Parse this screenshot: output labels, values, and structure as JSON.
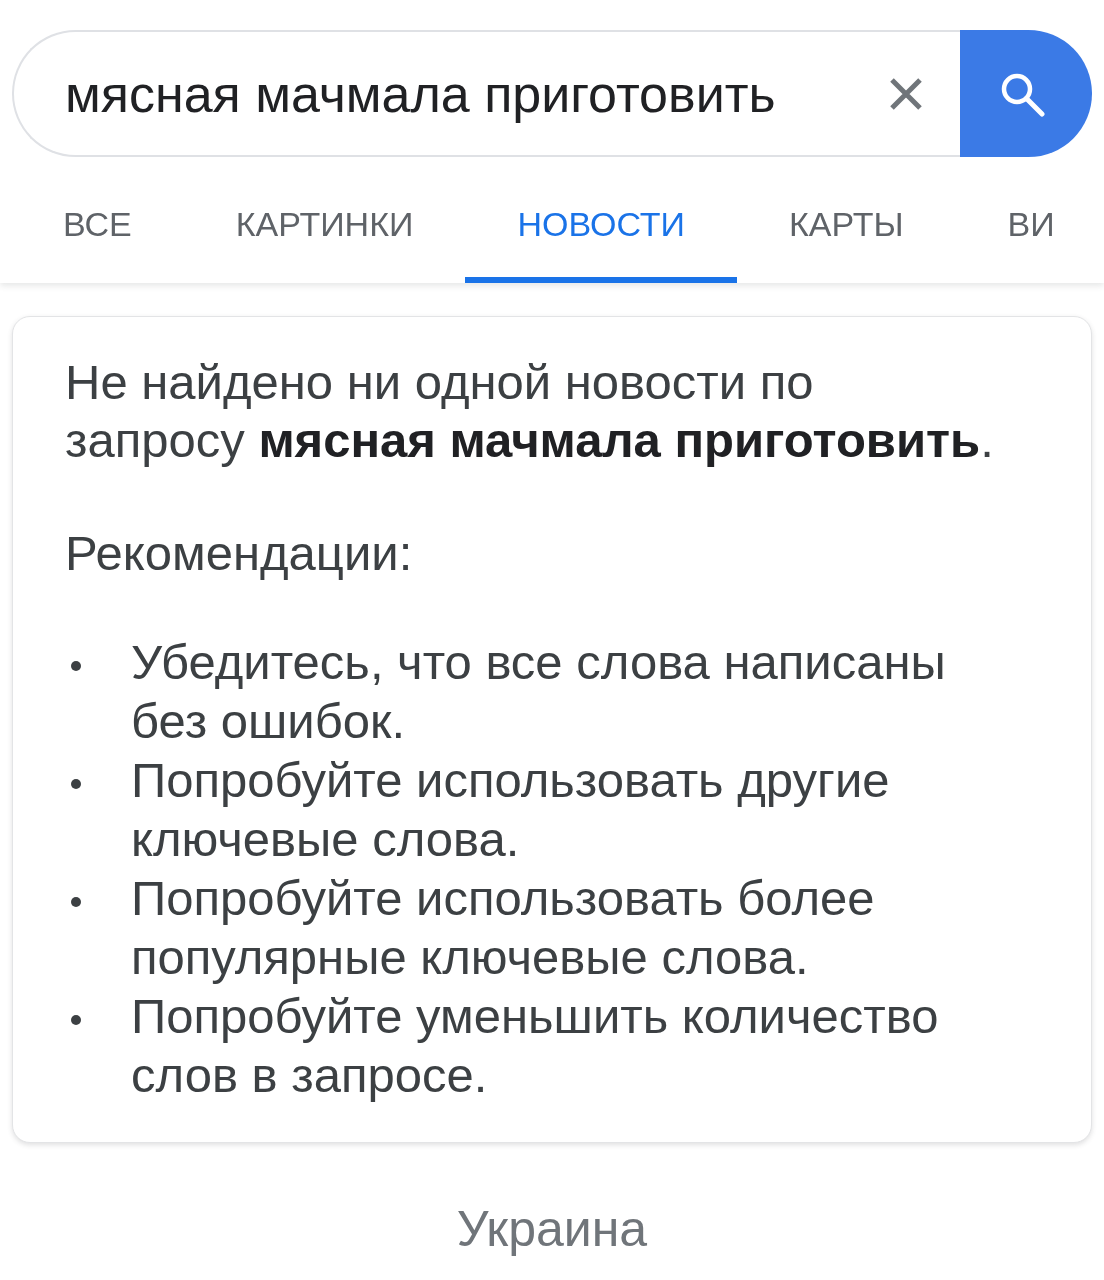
{
  "search": {
    "value": "мясная мачмала приготовить"
  },
  "tabs": [
    {
      "label": "ВСЕ",
      "selected": false
    },
    {
      "label": "КАРТИНКИ",
      "selected": false
    },
    {
      "label": "НОВОСТИ",
      "selected": true
    },
    {
      "label": "КАРТЫ",
      "selected": false
    },
    {
      "label": "ВИ",
      "selected": false
    }
  ],
  "result_card": {
    "message": "Не найдено ни одной новости по запросу **мясная мачмала приготовить**.",
    "suggestions_heading": "Рекомендации:",
    "suggestions": [
      "Убедитесь, что все слова написаны без ошибок.",
      "Попробуйте использовать другие ключевые слова.",
      "Попробуйте использовать более популярные ключевые слова.",
      "Попробуйте уменьшить количество слов в запросе."
    ]
  },
  "footer": {
    "location": "Украина"
  }
}
